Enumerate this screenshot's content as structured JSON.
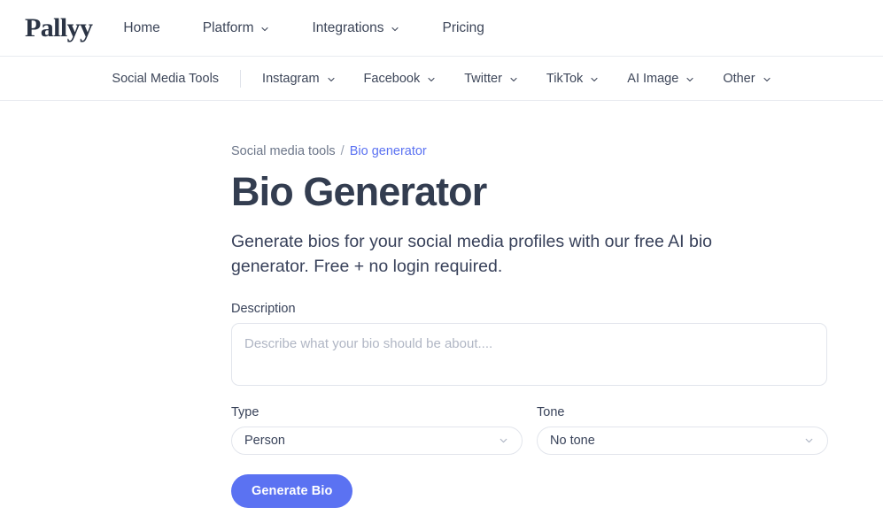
{
  "brand": {
    "logo_text": "Pallyy"
  },
  "topnav": {
    "items": [
      {
        "label": "Home",
        "has_chevron": false
      },
      {
        "label": "Platform",
        "has_chevron": true
      },
      {
        "label": "Integrations",
        "has_chevron": true
      },
      {
        "label": "Pricing",
        "has_chevron": false
      }
    ]
  },
  "subnav": {
    "items": [
      {
        "label": "Social Media Tools",
        "has_chevron": false,
        "divider_after": true
      },
      {
        "label": "Instagram",
        "has_chevron": true,
        "divider_after": false
      },
      {
        "label": "Facebook",
        "has_chevron": true,
        "divider_after": false
      },
      {
        "label": "Twitter",
        "has_chevron": true,
        "divider_after": false
      },
      {
        "label": "TikTok",
        "has_chevron": true,
        "divider_after": false
      },
      {
        "label": "AI Image",
        "has_chevron": true,
        "divider_after": false
      },
      {
        "label": "Other",
        "has_chevron": true,
        "divider_after": false
      }
    ]
  },
  "breadcrumb": {
    "root": "Social media tools",
    "separator": "/",
    "current": "Bio generator"
  },
  "main": {
    "title": "Bio Generator",
    "description": "Generate bios for your social media profiles with our free AI bio generator. Free + no login required."
  },
  "form": {
    "description_label": "Description",
    "description_placeholder": "Describe what your bio should be about....",
    "description_value": "",
    "type_label": "Type",
    "type_value": "Person",
    "type_options": [
      "Person"
    ],
    "tone_label": "Tone",
    "tone_value": "No tone",
    "tone_options": [
      "No tone"
    ],
    "submit_label": "Generate Bio"
  },
  "colors": {
    "accent": "#5b72f2",
    "heading": "#333d50",
    "text": "#39435a",
    "muted": "#6c7689",
    "border": "#e2e5ec",
    "nav_border": "#e8ebf0"
  }
}
